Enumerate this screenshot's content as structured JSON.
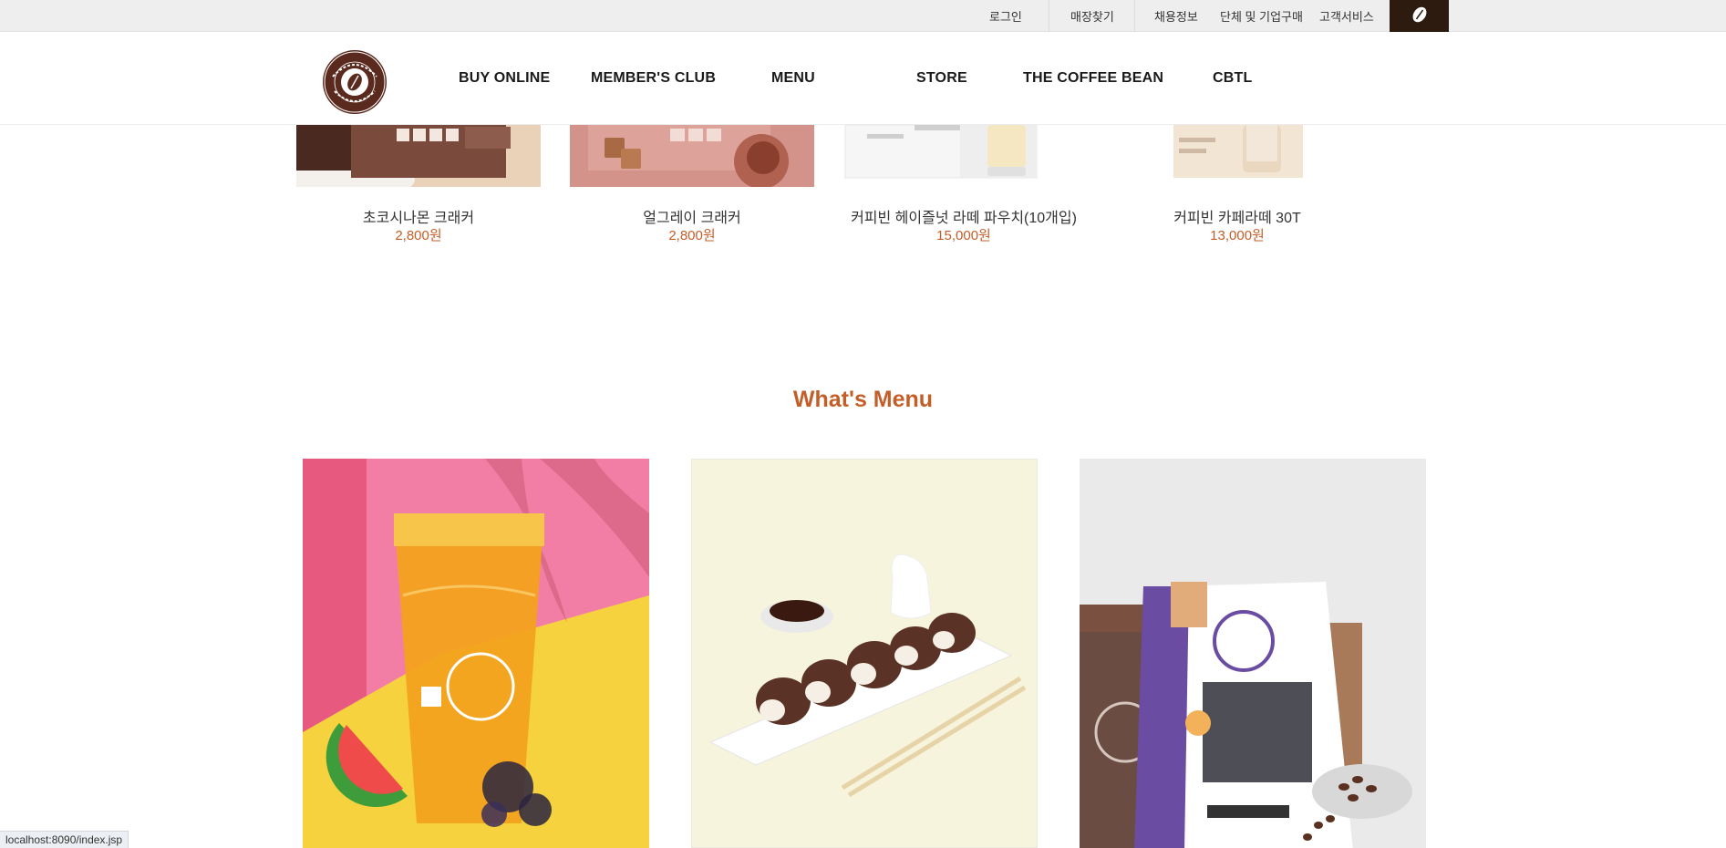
{
  "utility": {
    "login": "로그인",
    "store_finder": "매장찾기",
    "recruit": "채용정보",
    "corporate": "단체 및 기업구매",
    "customer": "고객서비스"
  },
  "gnb": {
    "items": [
      "BUY ONLINE",
      "MEMBER'S CLUB",
      "MENU",
      "STORE",
      "THE COFFEE BEAN",
      "CBTL"
    ]
  },
  "products": [
    {
      "name": "초코시나몬 크래커",
      "price": "2,800원"
    },
    {
      "name": "얼그레이 크래커",
      "price": "2,800원"
    },
    {
      "name": "커피빈 헤이즐넛 라떼 파우치(10개입)",
      "price": "15,000원"
    },
    {
      "name": "커피빈 카페라떼 30T",
      "price": "13,000원"
    }
  ],
  "whats_menu": {
    "title": "What's Menu"
  },
  "status_bar": {
    "url": "localhost:8090/index.jsp"
  },
  "colors": {
    "accent": "#c45e28",
    "brand_dark": "#2e1b10",
    "logo_brown": "#5a2a1f"
  },
  "icons": {
    "bean": "coffee-bean-icon"
  }
}
